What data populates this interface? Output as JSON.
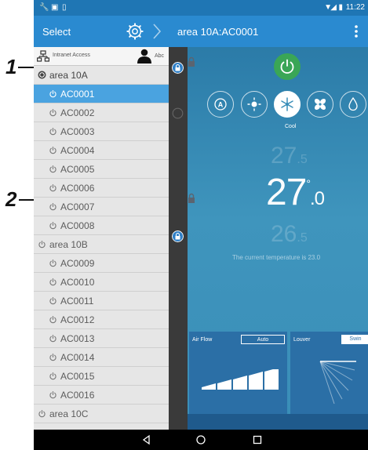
{
  "status_bar": {
    "time": "11:22"
  },
  "title_bar": {
    "select_label": "Select",
    "unit_title": "area 10A:AC0001"
  },
  "list_header": {
    "network_label": "Intranet Access",
    "user_label": "Abc"
  },
  "list": [
    {
      "kind": "area",
      "label": "area 10A",
      "selected": false
    },
    {
      "kind": "unit",
      "label": "AC0001",
      "selected": true
    },
    {
      "kind": "unit",
      "label": "AC0002",
      "selected": false
    },
    {
      "kind": "unit",
      "label": "AC0003",
      "selected": false
    },
    {
      "kind": "unit",
      "label": "AC0004",
      "selected": false
    },
    {
      "kind": "unit",
      "label": "AC0005",
      "selected": false
    },
    {
      "kind": "unit",
      "label": "AC0006",
      "selected": false
    },
    {
      "kind": "unit",
      "label": "AC0007",
      "selected": false
    },
    {
      "kind": "unit",
      "label": "AC0008",
      "selected": false
    },
    {
      "kind": "area",
      "label": "area 10B",
      "selected": false
    },
    {
      "kind": "unit",
      "label": "AC0009",
      "selected": false
    },
    {
      "kind": "unit",
      "label": "AC0010",
      "selected": false
    },
    {
      "kind": "unit",
      "label": "AC0011",
      "selected": false
    },
    {
      "kind": "unit",
      "label": "AC0012",
      "selected": false
    },
    {
      "kind": "unit",
      "label": "AC0013",
      "selected": false
    },
    {
      "kind": "unit",
      "label": "AC0014",
      "selected": false
    },
    {
      "kind": "unit",
      "label": "AC0015",
      "selected": false
    },
    {
      "kind": "unit",
      "label": "AC0016",
      "selected": false
    },
    {
      "kind": "area",
      "label": "area 10C",
      "selected": false
    }
  ],
  "control": {
    "mode_label": "Cool",
    "modes": [
      "auto-mode-icon",
      "heat-mode-icon",
      "cool-mode-icon",
      "fan-mode-icon",
      "dry-mode-icon"
    ],
    "temp_up": {
      "int": "27",
      "dec": ".5"
    },
    "temp_set": {
      "int": "27",
      "dot": "°",
      "dec": ".0"
    },
    "temp_down": {
      "int": "26",
      "dec": ".5"
    },
    "current_temp_text": "The current temperature is 23.0",
    "airflow": {
      "title": "Air Flow",
      "value": "Auto",
      "level": 5
    },
    "louver": {
      "title": "Louver",
      "value": "Swin"
    }
  },
  "callouts": {
    "one": "1",
    "two": "2"
  },
  "colors": {
    "accent": "#2a8ad0",
    "selected_row": "#4aa3e0",
    "power_on": "#3aa656"
  }
}
